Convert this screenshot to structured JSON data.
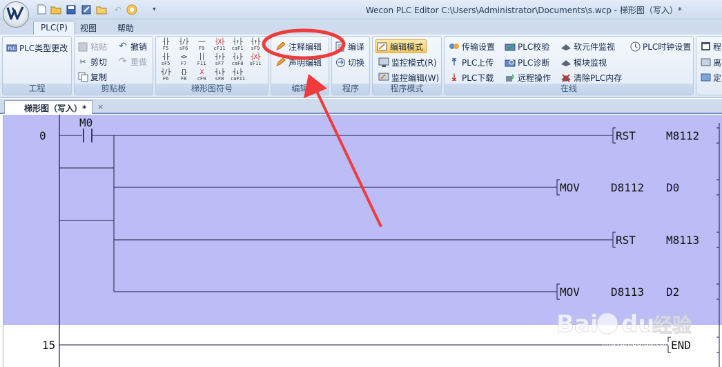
{
  "titlebar": {
    "app_logo": "W",
    "window_title": "Wecon PLC Editor  C:\\Users\\Administrator\\Documents\\s.wcp  - 梯形图（写入）*",
    "qat_icons": [
      "new-file-icon",
      "open-folder-icon",
      "save-icon",
      "save-as-icon",
      "folder-icon",
      "undo-icon",
      "config-icon",
      "dropdown-icon"
    ]
  },
  "menu": {
    "tabs": [
      "PLC(P)",
      "视图",
      "帮助"
    ],
    "active": "PLC(P)"
  },
  "ribbon": {
    "project": {
      "label": "工程",
      "plc_type_change": "PLC类型更改"
    },
    "clipboard": {
      "label": "剪贴板",
      "paste": "粘贴",
      "cut": "剪切",
      "copy": "复制",
      "undo": "撤销",
      "redo": "重做"
    },
    "ladder_symbols": {
      "label": "梯形图符号",
      "symbols": [
        {
          "glyph": "┤├",
          "key": "F5"
        },
        {
          "glyph": "┤/├",
          "key": "sF6"
        },
        {
          "glyph": "──",
          "key": "F9"
        },
        {
          "glyph": "┤X├",
          "key": "cF11"
        },
        {
          "glyph": "┤↑├",
          "key": "caF1"
        },
        {
          "glyph": "┤↑├",
          "key": "sF9"
        },
        {
          "glyph": "┤├",
          "key": "sF5"
        },
        {
          "glyph": "<>",
          "key": "F7"
        },
        {
          "glyph": "││",
          "key": "F11"
        },
        {
          "glyph": "┤↑├",
          "key": "sF7"
        },
        {
          "glyph": "┤↓├",
          "key": "caF8"
        },
        {
          "glyph": "┤X├",
          "key": "sF11"
        },
        {
          "glyph": "┤/├",
          "key": "F6"
        },
        {
          "glyph": "{}",
          "key": "F8"
        },
        {
          "glyph": "X",
          "key": "cF9"
        },
        {
          "glyph": "┤↓├",
          "key": "sF8"
        },
        {
          "glyph": "┤↓├",
          "key": "caF11"
        }
      ]
    },
    "edit": {
      "label": "编辑",
      "comment_edit": "注释编辑",
      "statement_edit": "声明编辑"
    },
    "program": {
      "label": "程序",
      "compile": "编译",
      "switch": "切换"
    },
    "program_mode": {
      "label": "程序模式",
      "edit_mode": "编辑模式",
      "monitor_mode": "监控模式(R)",
      "monitor_edit": "监控编辑(W)"
    },
    "online": {
      "label": "在线",
      "transfer_settings": "传输设置",
      "plc_upload": "PLC上传",
      "plc_download": "PLC下载",
      "plc_verify": "PLC校验",
      "plc_diagnose": "PLC诊断",
      "remote_operation": "远程操作",
      "device_monitor": "软元件监视",
      "module_monitor": "模块监视",
      "clear_plc_memory": "清除PLC内存",
      "plc_clock_settings": "PLC时钟设置"
    },
    "extra": {
      "item1": "程",
      "item2": "离",
      "item3": "定"
    }
  },
  "document": {
    "tab_title": "梯形图（写入）*",
    "close": "×"
  },
  "ladder": {
    "rungs": [
      {
        "step": "0",
        "contact": "M0",
        "outputs": [
          {
            "instr": "RST",
            "op1": "M8112",
            "op2": ""
          },
          {
            "instr": "MOV",
            "op1": "D8112",
            "op2": "D0"
          },
          {
            "instr": "RST",
            "op1": "M8113",
            "op2": ""
          },
          {
            "instr": "MOV",
            "op1": "D8113",
            "op2": "D2"
          }
        ]
      },
      {
        "step": "15",
        "outputs": [
          {
            "instr": "END",
            "op1": "",
            "op2": ""
          }
        ]
      }
    ]
  },
  "annotation": {
    "color": "#ee3b3b"
  },
  "watermark": {
    "brand": "Bai du 经验",
    "url": "jingyan.baidu.com"
  },
  "colors": {
    "selection": "#bcbdf7",
    "ribbon_highlight": "#f8c85c"
  }
}
